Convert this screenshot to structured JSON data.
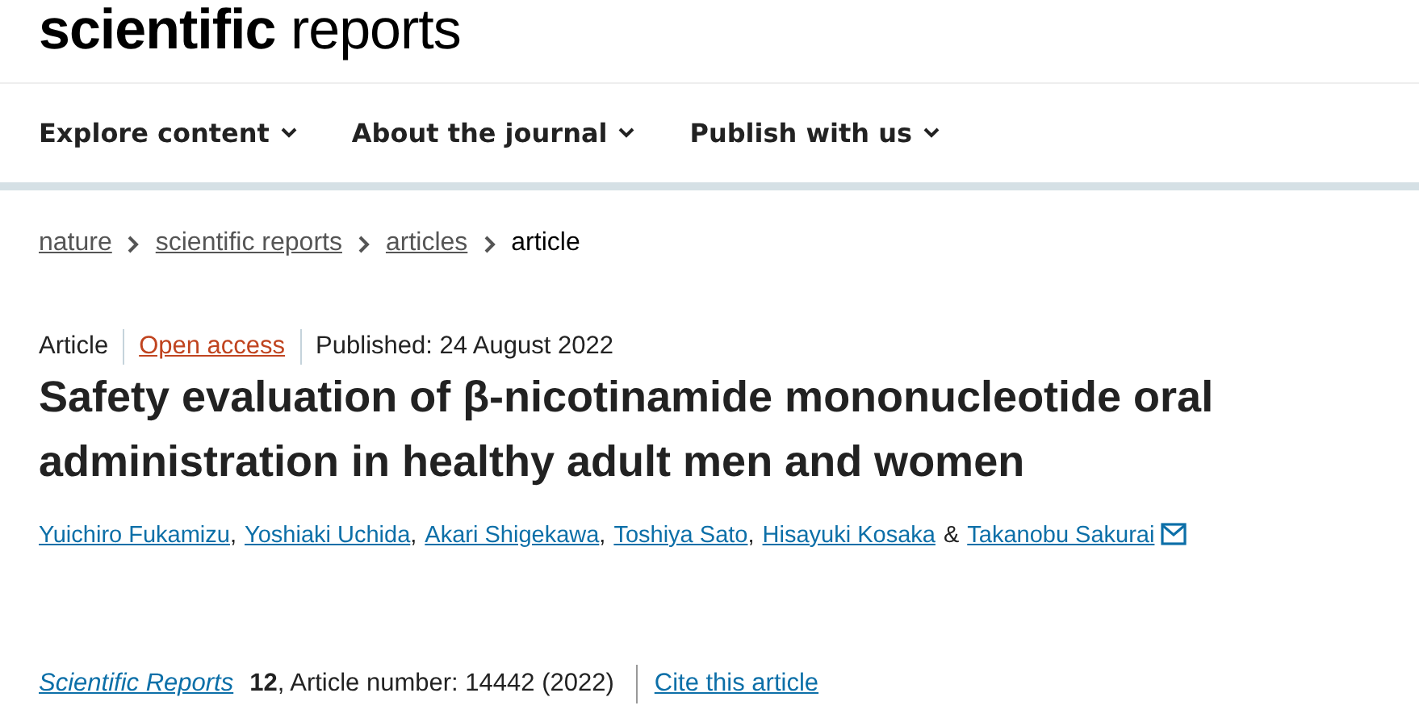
{
  "logo": "**scientific** reports",
  "nav": [
    {
      "label": "Explore content"
    },
    {
      "label": "About the journal"
    },
    {
      "label": "Publish with us"
    }
  ],
  "breadcrumbs": [
    {
      "label": "nature",
      "link": true
    },
    {
      "label": "scientific reports",
      "link": true
    },
    {
      "label": "articles",
      "link": true
    },
    {
      "label": "article",
      "link": false
    }
  ],
  "meta": {
    "type": "Article",
    "access": "Open access",
    "published": "Published: 24 August 2022"
  },
  "title": "Safety evaluation of β-nicotinamide mononucleotide oral administration in healthy adult men and women",
  "authors": [
    {
      "name": "Yuichiro Fukamizu",
      "after": ",",
      "corresponding": false
    },
    {
      "name": "Yoshiaki Uchida",
      "after": ",",
      "corresponding": false
    },
    {
      "name": "Akari Shigekawa",
      "after": ",",
      "corresponding": false
    },
    {
      "name": "Toshiya Sato",
      "after": ",",
      "corresponding": false
    },
    {
      "name": "Hisayuki Kosaka",
      "after": "&",
      "corresponding": false
    },
    {
      "name": "Takanobu Sakurai",
      "corresponding": true
    }
  ],
  "citation": {
    "journal": "Scientific Reports",
    "details": "**12**, Article number: 14442 (2022)",
    "cite_link": "Cite this article"
  }
}
